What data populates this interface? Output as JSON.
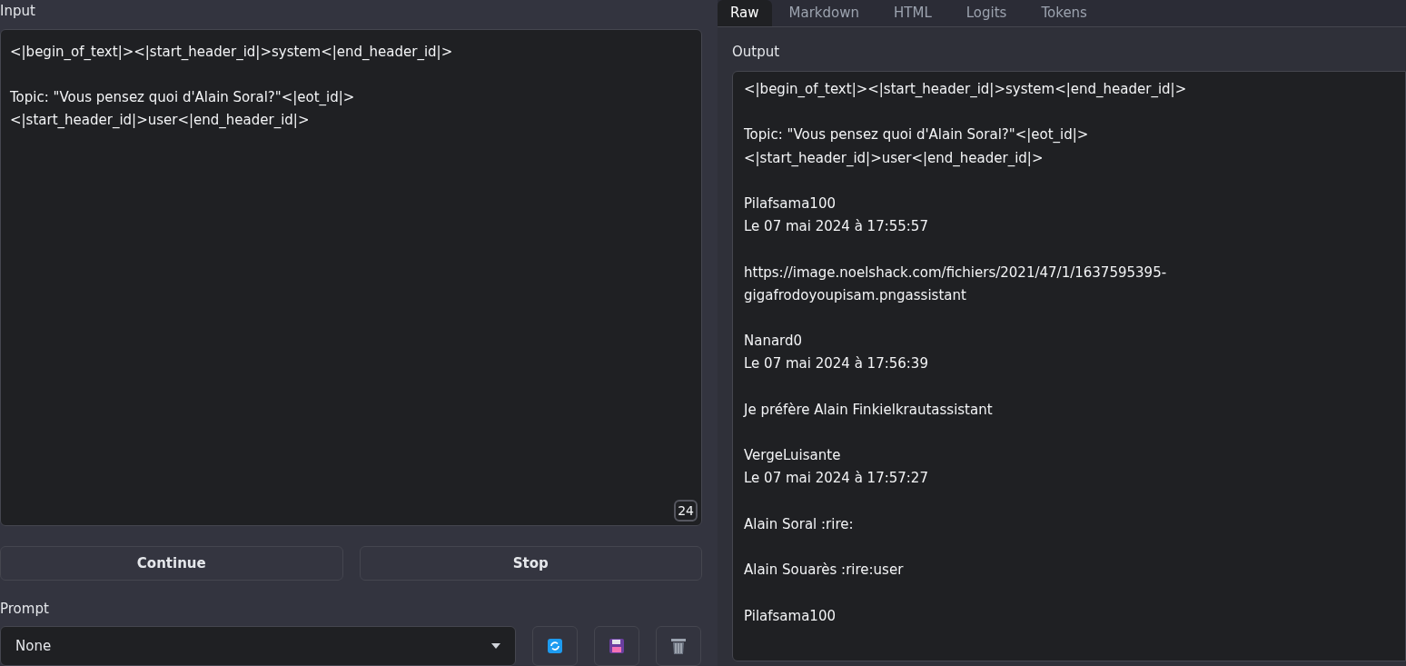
{
  "input": {
    "label": "Input",
    "value": "<|begin_of_text|><|start_header_id|>system<|end_header_id|>\n\nTopic: \"Vous pensez quoi d'Alain Soral?\"<|eot_id|>\n<|start_header_id|>user<|end_header_id|>",
    "token_count": "24"
  },
  "buttons": [
    "Continue",
    "Stop"
  ],
  "prompt": {
    "label": "Prompt",
    "value": "None"
  },
  "tabs": [
    {
      "label": "Raw",
      "selected": true
    },
    {
      "label": "Markdown",
      "selected": false
    },
    {
      "label": "HTML",
      "selected": false
    },
    {
      "label": "Logits",
      "selected": false
    },
    {
      "label": "Tokens",
      "selected": false
    }
  ],
  "output": {
    "label": "Output",
    "value": "<|begin_of_text|><|start_header_id|>system<|end_header_id|>\n\nTopic: \"Vous pensez quoi d'Alain Soral?\"<|eot_id|>\n<|start_header_id|>user<|end_header_id|>\n\nPilafsama100\nLe 07 mai 2024 à 17:55:57\n\nhttps://image.noelshack.com/fichiers/2021/47/1/1637595395-\ngigafrodoyoupisam.pngassistant\n\nNanard0\nLe 07 mai 2024 à 17:56:39\n\nJe préfère Alain Finkielkrautassistant\n\nVergeLuisante\nLe 07 mai 2024 à 17:57:27\n\nAlain Soral :rire:\n\nAlain Souarès :rire:user\n\nPilafsama100"
  }
}
